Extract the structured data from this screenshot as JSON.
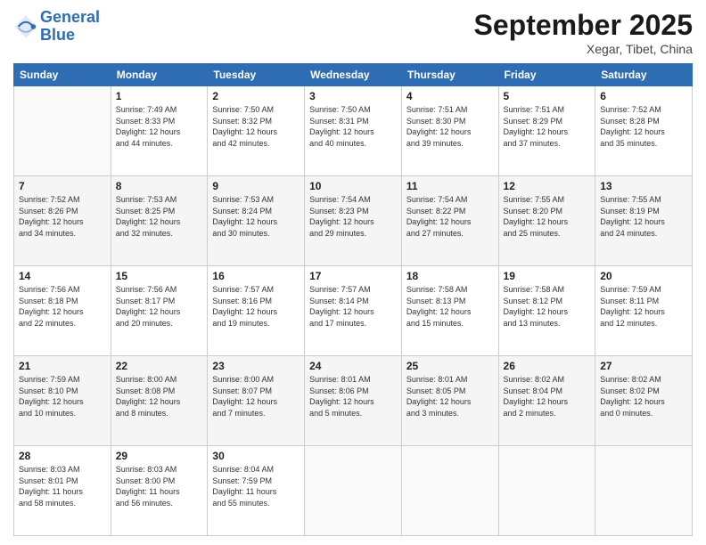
{
  "header": {
    "logo_line1": "General",
    "logo_line2": "Blue",
    "month": "September 2025",
    "location": "Xegar, Tibet, China"
  },
  "days_of_week": [
    "Sunday",
    "Monday",
    "Tuesday",
    "Wednesday",
    "Thursday",
    "Friday",
    "Saturday"
  ],
  "weeks": [
    [
      {
        "day": "",
        "info": ""
      },
      {
        "day": "1",
        "info": "Sunrise: 7:49 AM\nSunset: 8:33 PM\nDaylight: 12 hours\nand 44 minutes."
      },
      {
        "day": "2",
        "info": "Sunrise: 7:50 AM\nSunset: 8:32 PM\nDaylight: 12 hours\nand 42 minutes."
      },
      {
        "day": "3",
        "info": "Sunrise: 7:50 AM\nSunset: 8:31 PM\nDaylight: 12 hours\nand 40 minutes."
      },
      {
        "day": "4",
        "info": "Sunrise: 7:51 AM\nSunset: 8:30 PM\nDaylight: 12 hours\nand 39 minutes."
      },
      {
        "day": "5",
        "info": "Sunrise: 7:51 AM\nSunset: 8:29 PM\nDaylight: 12 hours\nand 37 minutes."
      },
      {
        "day": "6",
        "info": "Sunrise: 7:52 AM\nSunset: 8:28 PM\nDaylight: 12 hours\nand 35 minutes."
      }
    ],
    [
      {
        "day": "7",
        "info": "Sunrise: 7:52 AM\nSunset: 8:26 PM\nDaylight: 12 hours\nand 34 minutes."
      },
      {
        "day": "8",
        "info": "Sunrise: 7:53 AM\nSunset: 8:25 PM\nDaylight: 12 hours\nand 32 minutes."
      },
      {
        "day": "9",
        "info": "Sunrise: 7:53 AM\nSunset: 8:24 PM\nDaylight: 12 hours\nand 30 minutes."
      },
      {
        "day": "10",
        "info": "Sunrise: 7:54 AM\nSunset: 8:23 PM\nDaylight: 12 hours\nand 29 minutes."
      },
      {
        "day": "11",
        "info": "Sunrise: 7:54 AM\nSunset: 8:22 PM\nDaylight: 12 hours\nand 27 minutes."
      },
      {
        "day": "12",
        "info": "Sunrise: 7:55 AM\nSunset: 8:20 PM\nDaylight: 12 hours\nand 25 minutes."
      },
      {
        "day": "13",
        "info": "Sunrise: 7:55 AM\nSunset: 8:19 PM\nDaylight: 12 hours\nand 24 minutes."
      }
    ],
    [
      {
        "day": "14",
        "info": "Sunrise: 7:56 AM\nSunset: 8:18 PM\nDaylight: 12 hours\nand 22 minutes."
      },
      {
        "day": "15",
        "info": "Sunrise: 7:56 AM\nSunset: 8:17 PM\nDaylight: 12 hours\nand 20 minutes."
      },
      {
        "day": "16",
        "info": "Sunrise: 7:57 AM\nSunset: 8:16 PM\nDaylight: 12 hours\nand 19 minutes."
      },
      {
        "day": "17",
        "info": "Sunrise: 7:57 AM\nSunset: 8:14 PM\nDaylight: 12 hours\nand 17 minutes."
      },
      {
        "day": "18",
        "info": "Sunrise: 7:58 AM\nSunset: 8:13 PM\nDaylight: 12 hours\nand 15 minutes."
      },
      {
        "day": "19",
        "info": "Sunrise: 7:58 AM\nSunset: 8:12 PM\nDaylight: 12 hours\nand 13 minutes."
      },
      {
        "day": "20",
        "info": "Sunrise: 7:59 AM\nSunset: 8:11 PM\nDaylight: 12 hours\nand 12 minutes."
      }
    ],
    [
      {
        "day": "21",
        "info": "Sunrise: 7:59 AM\nSunset: 8:10 PM\nDaylight: 12 hours\nand 10 minutes."
      },
      {
        "day": "22",
        "info": "Sunrise: 8:00 AM\nSunset: 8:08 PM\nDaylight: 12 hours\nand 8 minutes."
      },
      {
        "day": "23",
        "info": "Sunrise: 8:00 AM\nSunset: 8:07 PM\nDaylight: 12 hours\nand 7 minutes."
      },
      {
        "day": "24",
        "info": "Sunrise: 8:01 AM\nSunset: 8:06 PM\nDaylight: 12 hours\nand 5 minutes."
      },
      {
        "day": "25",
        "info": "Sunrise: 8:01 AM\nSunset: 8:05 PM\nDaylight: 12 hours\nand 3 minutes."
      },
      {
        "day": "26",
        "info": "Sunrise: 8:02 AM\nSunset: 8:04 PM\nDaylight: 12 hours\nand 2 minutes."
      },
      {
        "day": "27",
        "info": "Sunrise: 8:02 AM\nSunset: 8:02 PM\nDaylight: 12 hours\nand 0 minutes."
      }
    ],
    [
      {
        "day": "28",
        "info": "Sunrise: 8:03 AM\nSunset: 8:01 PM\nDaylight: 11 hours\nand 58 minutes."
      },
      {
        "day": "29",
        "info": "Sunrise: 8:03 AM\nSunset: 8:00 PM\nDaylight: 11 hours\nand 56 minutes."
      },
      {
        "day": "30",
        "info": "Sunrise: 8:04 AM\nSunset: 7:59 PM\nDaylight: 11 hours\nand 55 minutes."
      },
      {
        "day": "",
        "info": ""
      },
      {
        "day": "",
        "info": ""
      },
      {
        "day": "",
        "info": ""
      },
      {
        "day": "",
        "info": ""
      }
    ]
  ]
}
